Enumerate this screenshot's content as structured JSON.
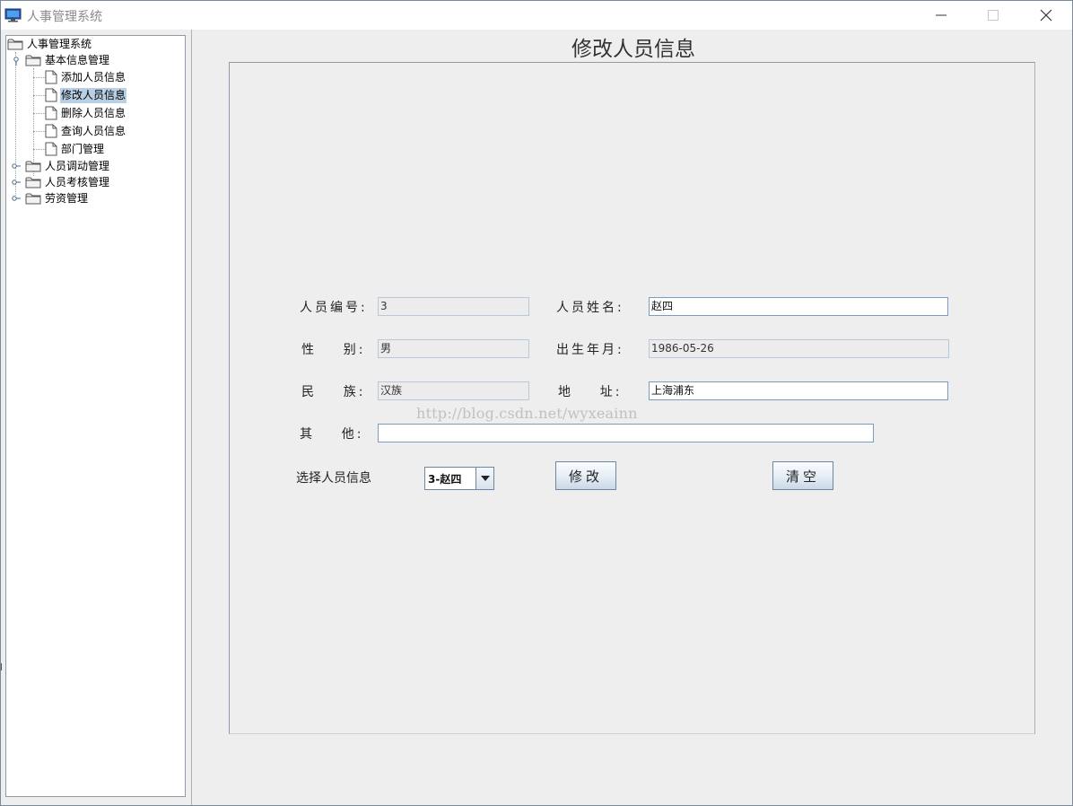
{
  "window": {
    "title": "人事管理系统"
  },
  "tree": {
    "root": "人事管理系统",
    "groups": [
      {
        "label": "基本信息管理",
        "expanded": true,
        "items": [
          "添加人员信息",
          "修改人员信息",
          "删除人员信息",
          "查询人员信息",
          "部门管理"
        ],
        "selected_item": "修改人员信息"
      },
      {
        "label": "人员调动管理",
        "expanded": false
      },
      {
        "label": "人员考核管理",
        "expanded": false
      },
      {
        "label": "劳资管理",
        "expanded": false
      }
    ]
  },
  "main": {
    "title": "修改人员信息",
    "form": {
      "employee_id": {
        "label": "人员编号:",
        "value": "3",
        "readonly": true
      },
      "employee_name": {
        "label": "人员姓名:",
        "value": "赵四",
        "readonly": false
      },
      "gender": {
        "label": "性    别:",
        "value": "男",
        "readonly": true
      },
      "birth": {
        "label": "出生年月:",
        "value": "1986-05-26",
        "readonly": true
      },
      "ethnicity": {
        "label": "民    族:",
        "value": "汉族",
        "readonly": true
      },
      "address": {
        "label": "地    址:",
        "value": "上海浦东",
        "readonly": false
      },
      "other": {
        "label": "其    他:",
        "value": "",
        "readonly": false
      }
    },
    "select_label": "选择人员信息",
    "select_value": "3-赵四",
    "modify_button": "修改",
    "clear_button": "清空"
  },
  "watermark": "http://blog.csdn.net/wyxeainn",
  "colors": {
    "window_bg": "#eeeeee",
    "selection": "#b8cfe5",
    "field_border": "#7a9cc0"
  }
}
